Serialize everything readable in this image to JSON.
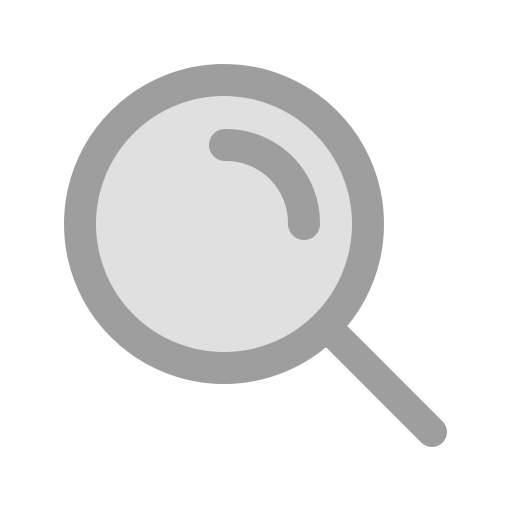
{
  "icon": {
    "name": "search-icon",
    "colors": {
      "stroke": "#9E9E9E",
      "lens_fill": "#E0E0E0",
      "background": "#FFFFFF"
    }
  }
}
